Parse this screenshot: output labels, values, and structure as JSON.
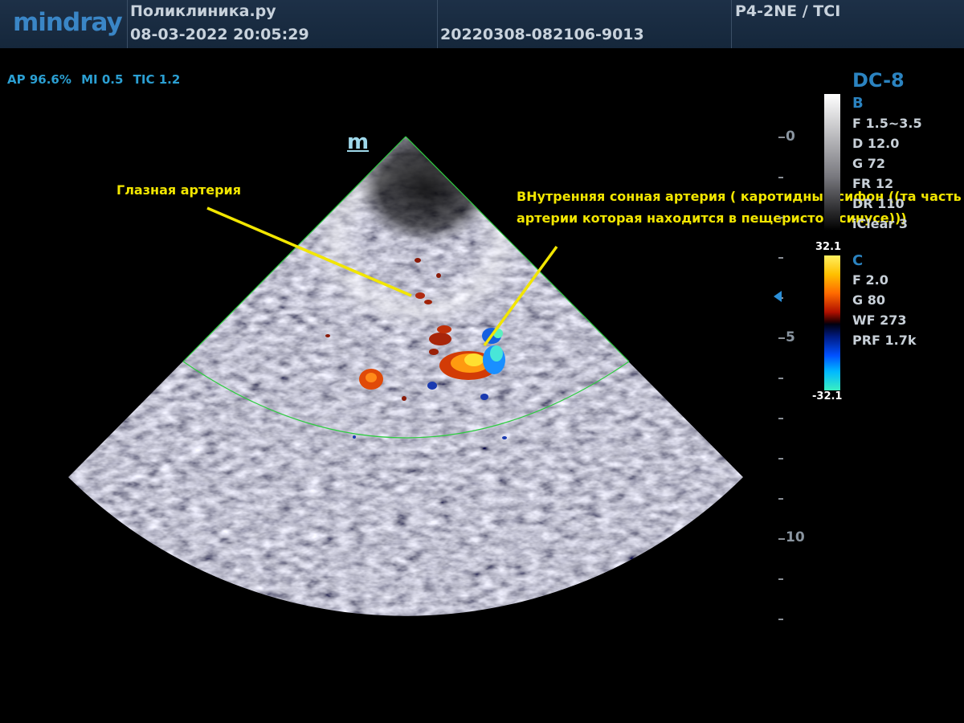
{
  "header": {
    "logo": "mindray",
    "institution": "Поликлиника.ру",
    "datetime": "08-03-2022  20:05:29",
    "exam_id": "20220308-082106-9013",
    "probe": "P4-2NE / TCI"
  },
  "acoustic": {
    "ap": "AP 96.6%",
    "mi": "MI 0.5",
    "tic": "TIC 1.2"
  },
  "mode_title": "DC-8",
  "b_mode": {
    "label": "B",
    "params": [
      "F 1.5~3.5",
      "D 12.0",
      "G 72",
      "FR 12",
      "DR 110",
      "iClear 3"
    ]
  },
  "color_mode": {
    "label": "C",
    "scale_max": "32.1",
    "scale_min": "-32.1",
    "params": [
      "F 2.0",
      "G 80",
      "WF 273",
      "PRF 1.7k"
    ]
  },
  "depth_scale": {
    "labels": [
      "0",
      "5",
      "10"
    ]
  },
  "image_marker": "m",
  "annotations": {
    "ophthalmic_artery": "Глазная артерия",
    "ica_line1": "ВНутренняя сонная артерия ( каротидный сифон ((та часть",
    "ica_line2": "артерии которая находится в пещеристом синусе)))"
  },
  "colors": {
    "header_bg": "#1a2c42",
    "accent_blue": "#2b83c0",
    "annotation_yellow": "#f2e600",
    "roi_green": "#2ecc40"
  }
}
